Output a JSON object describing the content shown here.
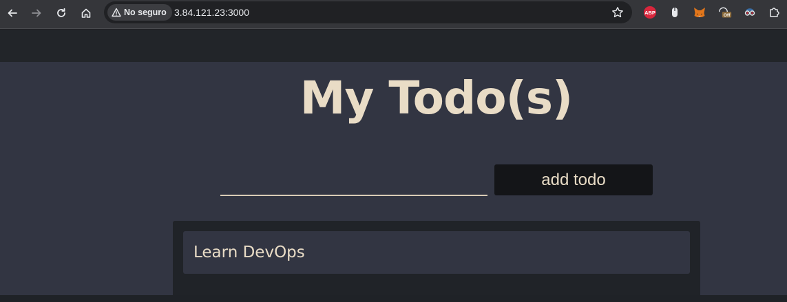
{
  "browser": {
    "security_label": "No seguro",
    "url": "3.84.121.23:3000",
    "extensions": [
      {
        "name": "adblock-plus-icon",
        "label": "ABP",
        "color": "#d9263c"
      },
      {
        "name": "mouse-extension-icon",
        "label": "",
        "color": "#e8eaed"
      },
      {
        "name": "metamask-fox-icon",
        "label": "",
        "color": "#e2761b"
      },
      {
        "name": "off-toggle-extension-icon",
        "label": "Off",
        "color": "#8a6a3a"
      },
      {
        "name": "glasses-extension-icon",
        "label": "",
        "color": "#c8c8c8"
      },
      {
        "name": "puzzle-extensions-icon",
        "label": "",
        "color": "#e8eaed"
      }
    ]
  },
  "app": {
    "title": "My Todo(s)",
    "input_value": "",
    "input_placeholder": "",
    "add_button_label": "add todo",
    "todos": [
      {
        "text": "Learn DevOps"
      }
    ]
  },
  "colors": {
    "page_bg": "#323542",
    "panel_bg": "#202328",
    "text_cream": "#e9dcc6",
    "button_bg": "#141518"
  }
}
